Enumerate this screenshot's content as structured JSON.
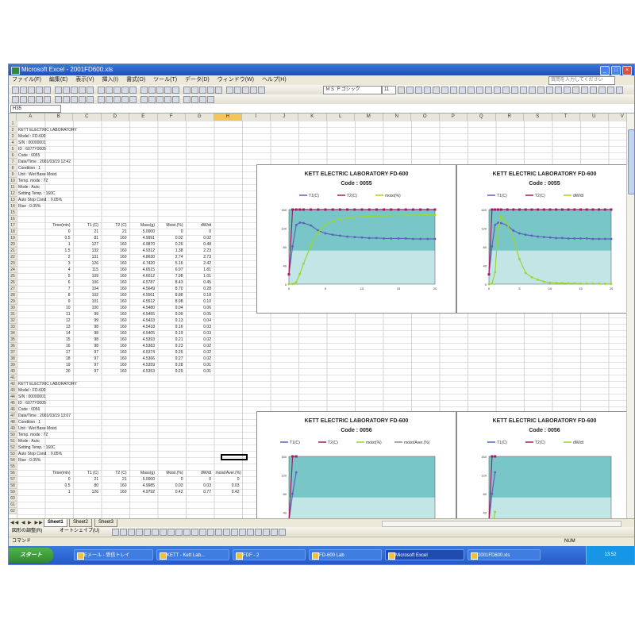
{
  "window": {
    "title": "Microsoft Excel - 2001FD600.xls",
    "menu": [
      "ファイル(F)",
      "編集(E)",
      "表示(V)",
      "挿入(I)",
      "書式(O)",
      "ツール(T)",
      "データ(D)",
      "ウィンドウ(W)",
      "ヘルプ(H)"
    ],
    "help_placeholder": "質問を入力してください",
    "font_name": "ＭＳ Ｐゴシック",
    "font_size": "11",
    "name_box": "H35"
  },
  "columns": [
    "A",
    "B",
    "C",
    "D",
    "E",
    "F",
    "G",
    "H",
    "I",
    "J",
    "K",
    "L",
    "M",
    "N",
    "O",
    "P",
    "Q",
    "R",
    "S",
    "T",
    "U",
    "V"
  ],
  "block1": {
    "info": [
      "KETT ELECTRIC LABORATORY",
      "Model : FD-600",
      "S/N : 00000001",
      "ID : 6077Y0005",
      "Code : 0055",
      "Date/Time : 2001/03/19 12:42",
      "Condition : 1",
      "Unit : Wet Base Moist.",
      "Temp. mode : 72",
      "Mode : Auto",
      "Setting Temp. : 160C",
      "Auto Stop Cond. : 0.05%",
      "Rise : 0.05%"
    ],
    "headers": [
      "Time(min)",
      "T1 (C)",
      "T2 (C)",
      "Mass(g)",
      "Moist.(%)",
      "dW/dt"
    ],
    "rows": [
      [
        "0",
        "21",
        "21",
        "5.0000",
        "0",
        "0"
      ],
      [
        "0.5",
        "81",
        "160",
        "4.9991",
        "0.02",
        "0.02"
      ],
      [
        "1",
        "127",
        "160",
        "4.9870",
        "0.26",
        "0.48"
      ],
      [
        "1.5",
        "132",
        "160",
        "4.9312",
        "1.38",
        "2.23"
      ],
      [
        "2",
        "131",
        "160",
        "4.8630",
        "2.74",
        "2.73"
      ],
      [
        "3",
        "126",
        "160",
        "4.7420",
        "5.16",
        "2.42"
      ],
      [
        "4",
        "115",
        "160",
        "4.6515",
        "6.97",
        "1.81"
      ],
      [
        "5",
        "109",
        "160",
        "4.6012",
        "7.98",
        "1.01"
      ],
      [
        "6",
        "106",
        "160",
        "4.5787",
        "8.43",
        "0.45"
      ],
      [
        "7",
        "104",
        "160",
        "4.5649",
        "8.70",
        "0.28"
      ],
      [
        "8",
        "102",
        "160",
        "4.5561",
        "8.88",
        "0.18"
      ],
      [
        "9",
        "101",
        "160",
        "4.5512",
        "8.98",
        "0.10"
      ],
      [
        "10",
        "100",
        "160",
        "4.5480",
        "9.04",
        "0.06"
      ],
      [
        "11",
        "99",
        "160",
        "4.5455",
        "9.09",
        "0.05"
      ],
      [
        "12",
        "99",
        "160",
        "4.5433",
        "9.13",
        "0.04"
      ],
      [
        "13",
        "98",
        "160",
        "4.5418",
        "9.16",
        "0.03"
      ],
      [
        "14",
        "98",
        "160",
        "4.5405",
        "9.19",
        "0.03"
      ],
      [
        "15",
        "98",
        "160",
        "4.5393",
        "9.21",
        "0.02"
      ],
      [
        "16",
        "98",
        "160",
        "4.5383",
        "9.23",
        "0.02"
      ],
      [
        "17",
        "97",
        "160",
        "4.5374",
        "9.25",
        "0.02"
      ],
      [
        "18",
        "97",
        "160",
        "4.5366",
        "9.27",
        "0.02"
      ],
      [
        "19",
        "97",
        "160",
        "4.5359",
        "9.28",
        "0.01"
      ],
      [
        "20",
        "97",
        "160",
        "4.5353",
        "9.29",
        "0.01"
      ]
    ]
  },
  "block2": {
    "info": [
      "KETT ELECTRIC LABORATORY",
      "Model : FD-600",
      "S/N : 00000001",
      "ID : 6077Y0005",
      "Code : 0056",
      "Date/Time : 2001/03/19 13:07",
      "Condition : 1",
      "Unit : Wet Base Moist.",
      "Temp. mode : 72",
      "Mode : Auto",
      "Setting Temp. : 160C",
      "Auto Stop Cond. : 0.05%",
      "Rise : 0.05%"
    ],
    "headers": [
      "Time(min)",
      "T1 (C)",
      "T2 (C)",
      "Mass(g)",
      "Moist.(%)",
      "dW/dt",
      "moist/Aver.(%)"
    ],
    "rows": [
      [
        "0",
        "21",
        "21",
        "5.0000",
        "0",
        "0",
        "0"
      ],
      [
        "0.5",
        "80",
        "160",
        "4.9985",
        "0.03",
        "0.03",
        "0.03"
      ],
      [
        "1",
        "126",
        "160",
        "4.9792",
        "0.42",
        "0.77",
        "0.42"
      ]
    ]
  },
  "charts": [
    {
      "title": "KETT ELECTRIC LABORATORY FD-600",
      "code": "Code : 0055",
      "legend": [
        "T1(C)",
        "T2(C)",
        "moist(%)"
      ]
    },
    {
      "title": "KETT ELECTRIC LABORATORY FD-600",
      "code": "Code : 0055",
      "legend": [
        "T1(C)",
        "T2(C)",
        "dW/dt"
      ]
    },
    {
      "title": "KETT ELECTRIC LABORATORY FD-600",
      "code": "Code : 0056",
      "legend": [
        "T1(C)",
        "T2(C)",
        "moist(%)",
        "moist/Aver.(%)"
      ]
    },
    {
      "title": "KETT ELECTRIC LABORATORY FD-600",
      "code": "Code : 0056",
      "legend": [
        "T1(C)",
        "T2(C)",
        "dW/dt"
      ]
    }
  ],
  "sheet_tabs": [
    "Sheet1",
    "Sheet2",
    "Sheet3"
  ],
  "draw_label": "図形の調整(R)",
  "autoshape_label": "オートシェイプ(U)",
  "status": {
    "left": "コマンド",
    "right": "NUM"
  },
  "taskbar": {
    "start": "スタート",
    "items": [
      "Eメール - 受信トレイ",
      "KETT - Kett Lab...",
      "FDF - 2",
      "FD-600 Lab",
      "Microsoft Excel",
      "2001FD600.xls"
    ],
    "clock": "13:52"
  },
  "colors": {
    "t1": "#5a63b8",
    "t2": "#a01f62",
    "moist": "#9bd62e",
    "plot_bg": "#78c6c8"
  }
}
